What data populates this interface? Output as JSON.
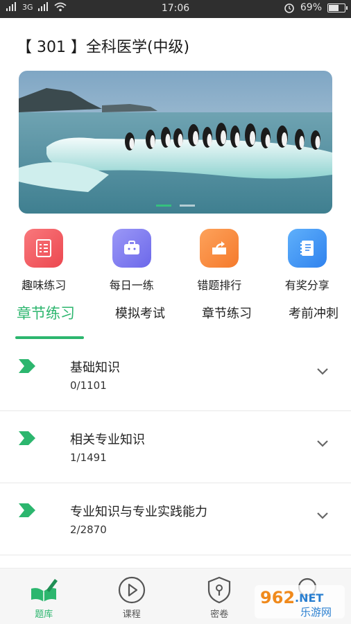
{
  "status_bar": {
    "signal_text": "3G",
    "time": "17:06",
    "battery_percent": "69%",
    "battery_level": 0.69
  },
  "header": {
    "title": "【 301 】全科医学(中级)"
  },
  "banner": {
    "active_index": 0,
    "slide_count": 2
  },
  "quick_actions": [
    {
      "label": "趣味练习",
      "icon": "checklist-icon",
      "color": "#f0565f"
    },
    {
      "label": "每日一练",
      "icon": "briefcase-icon",
      "color": "#7b78f0"
    },
    {
      "label": "错题排行",
      "icon": "share-box-icon",
      "color": "#fb8a3a"
    },
    {
      "label": "有奖分享",
      "icon": "notebook-icon",
      "color": "#3a8ef5"
    }
  ],
  "tabs": [
    {
      "label": "章节练习",
      "active": true
    },
    {
      "label": "模拟考试",
      "active": false
    },
    {
      "label": "章节练习",
      "active": false
    },
    {
      "label": "考前冲刺",
      "active": false
    }
  ],
  "chapters": [
    {
      "name": "基础知识",
      "progress": "0/1101"
    },
    {
      "name": "相关专业知识",
      "progress": "1/1491"
    },
    {
      "name": "专业知识与专业实践能力",
      "progress": "2/2870"
    }
  ],
  "bottom_nav": [
    {
      "label": "题库",
      "icon": "book-pen-icon",
      "active": true
    },
    {
      "label": "课程",
      "icon": "play-circle-icon",
      "active": false
    },
    {
      "label": "密卷",
      "icon": "shield-lock-icon",
      "active": false
    },
    {
      "label": "",
      "icon": "user-icon",
      "active": false
    }
  ],
  "watermark": {
    "line1": "962.NET",
    "line2": "乐游网"
  },
  "colors": {
    "accent": "#2cb66e",
    "status_bar": "#2f2f2f"
  }
}
